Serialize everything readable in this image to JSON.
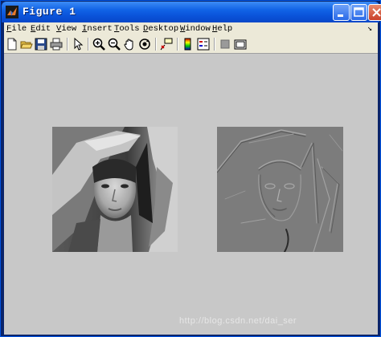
{
  "window": {
    "title": "Figure 1"
  },
  "menubar": {
    "items": [
      {
        "label": "File",
        "key": "F",
        "rest": "ile"
      },
      {
        "label": "Edit",
        "key": "E",
        "rest": "dit"
      },
      {
        "label": "View",
        "key": "V",
        "rest": "iew"
      },
      {
        "label": "Insert",
        "key": "I",
        "rest": "nsert"
      },
      {
        "label": "Tools",
        "key": "T",
        "rest": "ools"
      },
      {
        "label": "Desktop",
        "key": "D",
        "rest": "esktop"
      },
      {
        "label": "Window",
        "key": "W",
        "rest": "indow"
      },
      {
        "label": "Help",
        "key": "H",
        "rest": "elp"
      }
    ],
    "dock_glyph": "↘"
  },
  "toolbar": {
    "icons": [
      "new-figure-icon",
      "open-file-icon",
      "save-icon",
      "print-icon",
      "edit-plot-arrow-icon",
      "zoom-in-icon",
      "zoom-out-icon",
      "pan-hand-icon",
      "rotate-3d-icon",
      "data-cursor-icon",
      "colorbar-icon",
      "legend-icon",
      "hide-plot-tools-icon",
      "show-plot-tools-icon"
    ]
  },
  "figure": {
    "background": "#c8c8c8",
    "images": [
      {
        "name": "grayscale-portrait"
      },
      {
        "name": "embossed-edge-filtered-portrait"
      }
    ],
    "watermark": "http://blog.csdn.net/dai_ser"
  }
}
